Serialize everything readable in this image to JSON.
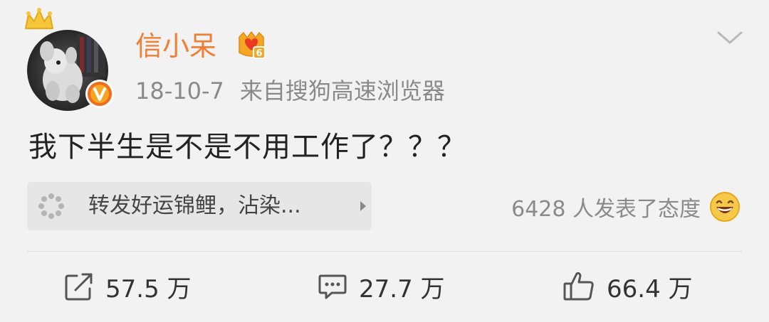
{
  "user": {
    "name": "信小呆"
  },
  "post": {
    "date": "18-10-7",
    "source": "来自搜狗高速浏览器",
    "text": "我下半生是不是不用工作了？？？"
  },
  "repost_card": {
    "text": "转发好运锦鲤，沾染..."
  },
  "reactions": {
    "text": "6428 人发表了态度"
  },
  "actions": {
    "repost_count": "57.5 万",
    "comment_count": "27.7 万",
    "like_count": "66.4 万"
  },
  "colors": {
    "username": "#f17e32",
    "meta": "#8a8a8a",
    "background": "#f2f2f2",
    "card": "#e6e6e6",
    "vip_badge": "#f5a623",
    "verified_orange": "#f26b1d"
  }
}
